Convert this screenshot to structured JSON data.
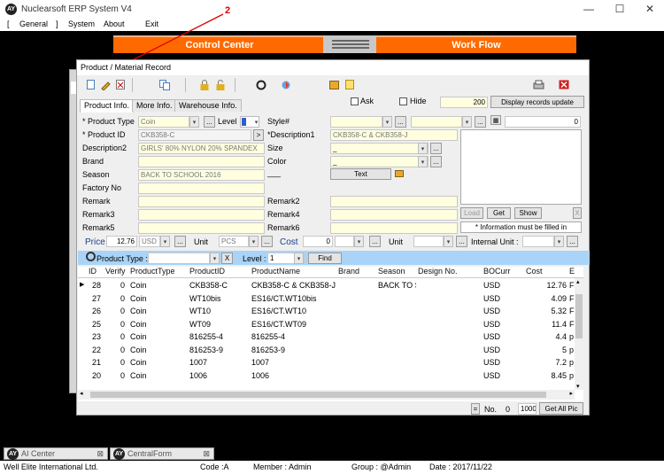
{
  "window": {
    "title": "Nuclearsoft ERP System V4",
    "min": "—",
    "max": "☐",
    "close": "✕"
  },
  "menu": {
    "open": "[",
    "general": "General",
    "close": "]",
    "system": "System",
    "about": "About",
    "exit": "Exit"
  },
  "banner": {
    "left": "Control Center",
    "right": "Work Flow"
  },
  "annotation": {
    "number": "2"
  },
  "dialog": {
    "title": "Product / Material Record",
    "tabs": [
      "Product Info.",
      "More Info.",
      "Warehouse Info."
    ],
    "ask_label": "Ask",
    "hide_label": "Hide",
    "record_count": "200",
    "display_update": "Display records update",
    "fields": {
      "product_type_label": "* Product Type",
      "product_type": "Coin",
      "level_label": "Level",
      "product_id_label": "* Product ID",
      "product_id": "CKB358-C",
      "pid_btn": ">",
      "description2_label": "Description2",
      "description2": "GIRLS' 80% NYLON 20% SPANDEX",
      "brand_label": "Brand",
      "season_label": "Season",
      "season": "BACK TO SCHOOL 2016",
      "factory_label": "Factory No",
      "remark_label": "Remark",
      "remark3_label": "Remark3",
      "remark5_label": "Remark5",
      "style_label": "Style#",
      "description1_label": "*Description1",
      "description1": "CKB358-C & CKB358-J",
      "size_label": "Size",
      "size": "_",
      "color_label": "Color",
      "color": "_",
      "dash_label": "___",
      "text_btn": "Text",
      "remark2_label": "Remark2",
      "remark4_label": "Remark4",
      "remark6_label": "Remark6",
      "right_count": "0",
      "load_btn": "Load",
      "get_btn": "Get",
      "show_btn": "Show",
      "x_btn": "X",
      "info_note": "* Information must be filled in",
      "price_label": "Price",
      "price": "12.76",
      "currency": "USD",
      "unit_label": "Unit",
      "unit": "PCS",
      "cost_label": "Cost",
      "cost": "0",
      "unit2_label": "Unit",
      "internal_unit_label": "Internal Unit :",
      "dots": "..."
    },
    "filter": {
      "product_type_label": "Product Type :",
      "x": "X",
      "level_label": "Level :",
      "level": "1",
      "find": "Find"
    },
    "columns": [
      "ID",
      "Verify",
      "ProductType",
      "ProductID",
      "ProductName",
      "Brand",
      "Season",
      "Design No.",
      "BOCurr",
      "Cost",
      "E"
    ],
    "rows": [
      {
        "id": "28",
        "verify": "0",
        "type": "Coin",
        "pid": "CKB358-C",
        "name": "CKB358-C & CKB358-J",
        "season": "BACK TO S",
        "cur": "USD",
        "cost": "12.76",
        "e": "F"
      },
      {
        "id": "27",
        "verify": "0",
        "type": "Coin",
        "pid": "WT10bis",
        "name": "ES16/CT.WT10bis",
        "season": "",
        "cur": "USD",
        "cost": "4.09",
        "e": "F"
      },
      {
        "id": "26",
        "verify": "0",
        "type": "Coin",
        "pid": "WT10",
        "name": "ES16/CT.WT10",
        "season": "",
        "cur": "USD",
        "cost": "5.32",
        "e": "F"
      },
      {
        "id": "25",
        "verify": "0",
        "type": "Coin",
        "pid": "WT09",
        "name": "ES16/CT.WT09",
        "season": "",
        "cur": "USD",
        "cost": "11.4",
        "e": "F"
      },
      {
        "id": "23",
        "verify": "0",
        "type": "Coin",
        "pid": "816255-4",
        "name": "816255-4",
        "season": "",
        "cur": "USD",
        "cost": "4.4",
        "e": "p"
      },
      {
        "id": "22",
        "verify": "0",
        "type": "Coin",
        "pid": "816253-9",
        "name": "816253-9",
        "season": "",
        "cur": "USD",
        "cost": "5",
        "e": "p"
      },
      {
        "id": "21",
        "verify": "0",
        "type": "Coin",
        "pid": "1007",
        "name": "1007",
        "season": "",
        "cur": "USD",
        "cost": "7.2",
        "e": "p"
      },
      {
        "id": "20",
        "verify": "0",
        "type": "Coin",
        "pid": "1006",
        "name": "1006",
        "season": "",
        "cur": "USD",
        "cost": "8.45",
        "e": "p"
      }
    ],
    "bottom": {
      "eq": "=",
      "no_label": "No.",
      "no_value": "0",
      "page_size": "1000",
      "get_all": "Get All Pic"
    }
  },
  "taskbar": {
    "item1": "AI Center",
    "item2": "CentralForm",
    "close": "⊠"
  },
  "status": {
    "company": "Well Elite International Ltd.",
    "code": "Code :A",
    "member": "Member :  Admin",
    "group": "Group :  @Admin",
    "date": "Date :  2017/11/22"
  }
}
